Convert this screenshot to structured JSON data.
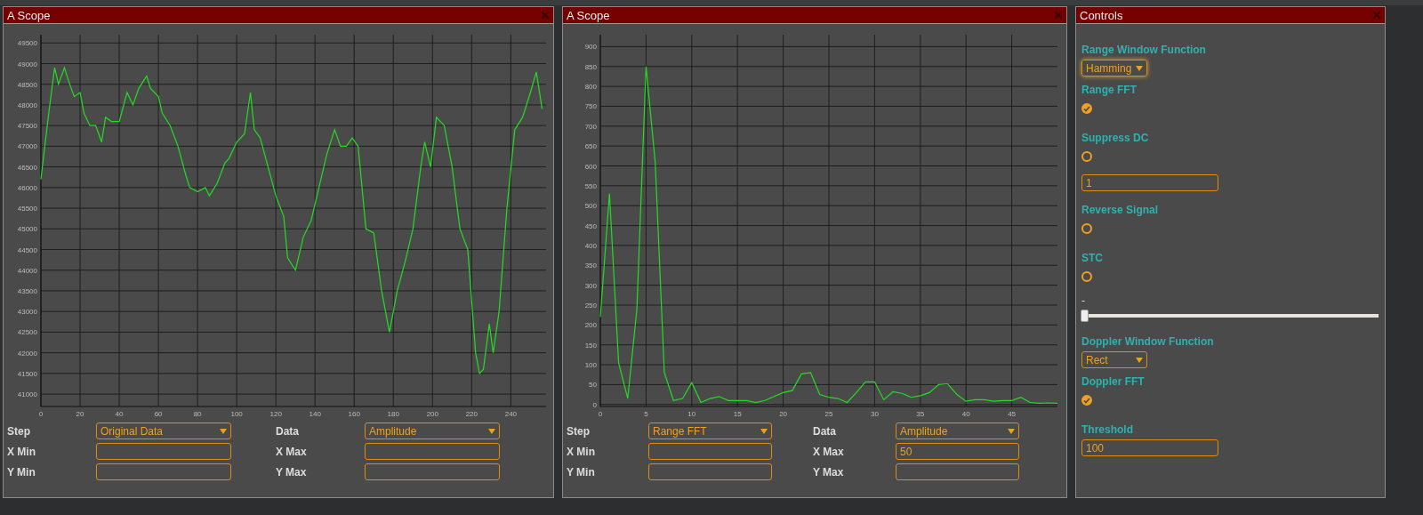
{
  "scopes": [
    {
      "title": "A Scope",
      "chart_data": {
        "type": "line",
        "x": [
          0,
          4,
          7,
          9,
          12,
          14,
          17,
          20,
          22,
          25,
          28,
          31,
          33,
          36,
          40,
          44,
          47,
          50,
          54,
          56,
          60,
          62,
          66,
          70,
          74,
          76,
          80,
          84,
          86,
          90,
          94,
          96,
          100,
          104,
          107,
          109,
          112,
          116,
          120,
          124,
          126,
          130,
          134,
          138,
          142,
          146,
          150,
          153,
          156,
          159,
          162,
          166,
          170,
          174,
          178,
          182,
          186,
          190,
          194,
          196,
          199,
          202,
          206,
          210,
          214,
          218,
          222,
          224,
          226,
          229,
          231,
          234,
          238,
          242,
          246,
          250,
          253,
          256
        ],
        "grid": true,
        "series": [
          {
            "color": "#22dd22",
            "values": [
              46200,
              47800,
              48900,
              48500,
              48900,
              48600,
              48200,
              48300,
              47800,
              47500,
              47500,
              47100,
              47700,
              47600,
              47600,
              48300,
              48000,
              48400,
              48700,
              48400,
              48200,
              47800,
              47500,
              47000,
              46300,
              46000,
              45900,
              46000,
              45800,
              46100,
              46600,
              46700,
              47100,
              47300,
              48300,
              47400,
              47200,
              46500,
              45800,
              45300,
              44300,
              44000,
              44800,
              45200,
              46000,
              46800,
              47400,
              47000,
              47000,
              47200,
              47000,
              45000,
              44900,
              43500,
              42500,
              43500,
              44200,
              45000,
              46500,
              47100,
              46500,
              47700,
              47500,
              46500,
              45000,
              44500,
              42000,
              41500,
              41600,
              42700,
              42000,
              43000,
              45500,
              47400,
              47700,
              48300,
              48800,
              47900
            ]
          }
        ],
        "xlim": [
          0,
          258
        ],
        "ylim": [
          40700,
          49700
        ],
        "xticks": [
          0,
          20,
          40,
          60,
          80,
          100,
          120,
          140,
          160,
          180,
          200,
          220,
          240
        ],
        "yticks": [
          41000,
          41500,
          42000,
          42500,
          43000,
          43500,
          44000,
          44500,
          45000,
          45500,
          46000,
          46500,
          47000,
          47500,
          48000,
          48500,
          49000,
          49500
        ]
      },
      "fields": [
        {
          "label": "Step",
          "kind": "select",
          "value": "Original Data"
        },
        {
          "label": "Data",
          "kind": "select",
          "value": "Amplitude"
        },
        {
          "label": "X Min",
          "kind": "input"
        },
        {
          "label": "X Max",
          "kind": "input"
        },
        {
          "label": "Y Min",
          "kind": "input"
        },
        {
          "label": "Y Max",
          "kind": "input"
        }
      ]
    },
    {
      "title": "A Scope",
      "chart_data": {
        "type": "line",
        "x": [
          0,
          1,
          2,
          3,
          4,
          5,
          6,
          7,
          8,
          9,
          10,
          11,
          12,
          13,
          14,
          15,
          16,
          17,
          18,
          19,
          20,
          21,
          22,
          23,
          24,
          25,
          26,
          27,
          28,
          29,
          30,
          31,
          32,
          33,
          34,
          35,
          36,
          37,
          38,
          39,
          40,
          41,
          42,
          43,
          44,
          45,
          46,
          47,
          48,
          49,
          50
        ],
        "grid": true,
        "series": [
          {
            "color": "#22dd22",
            "values": [
              220,
              530,
              105,
              15,
              240,
              850,
              610,
              80,
              10,
              15,
              55,
              5,
              15,
              20,
              10,
              10,
              10,
              5,
              10,
              20,
              30,
              35,
              77,
              80,
              25,
              18,
              15,
              5,
              30,
              57,
              57,
              12,
              32,
              28,
              18,
              22,
              30,
              50,
              52,
              25,
              8,
              12,
              12,
              8,
              10,
              10,
              18,
              5,
              3,
              4,
              3
            ]
          }
        ],
        "xlim": [
          0,
          50
        ],
        "ylim": [
          -5,
          930
        ],
        "xticks": [
          0,
          5,
          10,
          15,
          20,
          25,
          30,
          35,
          40,
          45
        ],
        "yticks": [
          0,
          50,
          100,
          150,
          200,
          250,
          300,
          350,
          400,
          450,
          500,
          550,
          600,
          650,
          700,
          750,
          800,
          850,
          900
        ]
      },
      "fields": [
        {
          "label": "Step",
          "kind": "select",
          "value": "Range FFT"
        },
        {
          "label": "Data",
          "kind": "select",
          "value": "Amplitude"
        },
        {
          "label": "X Min",
          "kind": "input"
        },
        {
          "label": "X Max",
          "kind": "input",
          "value": "50"
        },
        {
          "label": "Y Min",
          "kind": "input"
        },
        {
          "label": "Y Max",
          "kind": "input"
        }
      ]
    }
  ],
  "controls": {
    "title": "Controls",
    "items": [
      {
        "kind": "heading",
        "text": "Range Window Function"
      },
      {
        "kind": "select",
        "value": "Hamming",
        "focused": true
      },
      {
        "kind": "heading",
        "text": "Range FFT"
      },
      {
        "kind": "checkbox",
        "checked": true
      },
      {
        "kind": "heading",
        "text": "Suppress DC"
      },
      {
        "kind": "checkbox",
        "checked": false
      },
      {
        "kind": "input",
        "value": "1"
      },
      {
        "kind": "heading",
        "text": "Reverse Signal"
      },
      {
        "kind": "checkbox",
        "checked": false
      },
      {
        "kind": "heading",
        "text": "STC"
      },
      {
        "kind": "checkbox",
        "checked": false
      },
      {
        "kind": "text",
        "text": "-"
      },
      {
        "kind": "slider",
        "level": 0
      },
      {
        "kind": "heading",
        "text": "Doppler Window Function"
      },
      {
        "kind": "select",
        "value": "Rect",
        "focused": false
      },
      {
        "kind": "heading",
        "text": "Doppler FFT"
      },
      {
        "kind": "checkbox",
        "checked": true
      },
      {
        "kind": "heading",
        "text": "Threshold"
      },
      {
        "kind": "input",
        "value": "100"
      }
    ]
  }
}
